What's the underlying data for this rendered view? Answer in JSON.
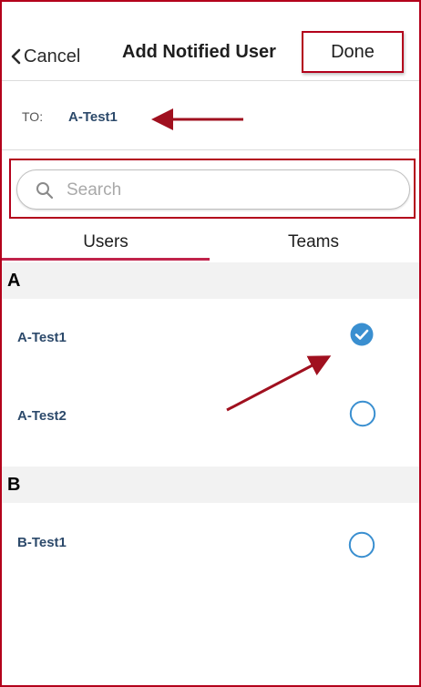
{
  "header": {
    "cancel_label": "Cancel",
    "title": "Add Notified User",
    "done_label": "Done"
  },
  "recipient": {
    "to_label": "TO:",
    "to_value": "A-Test1"
  },
  "search": {
    "placeholder": "Search",
    "value": ""
  },
  "tabs": [
    {
      "label": "Users",
      "active": true
    },
    {
      "label": "Teams",
      "active": false
    }
  ],
  "sections": [
    {
      "letter": "A",
      "users": [
        {
          "name": "A-Test1",
          "selected": true
        },
        {
          "name": "A-Test2",
          "selected": false
        }
      ]
    },
    {
      "letter": "B",
      "users": [
        {
          "name": "B-Test1",
          "selected": false
        }
      ]
    }
  ],
  "colors": {
    "annotation_red": "#b3001b",
    "accent_underline": "#c0234b",
    "check_blue": "#3a8fd0",
    "name_text": "#2d4a6b"
  },
  "icons": {
    "back": "chevron-left-icon",
    "search": "search-icon",
    "checked": "check-circle-filled-icon",
    "unchecked": "circle-outline-icon"
  }
}
